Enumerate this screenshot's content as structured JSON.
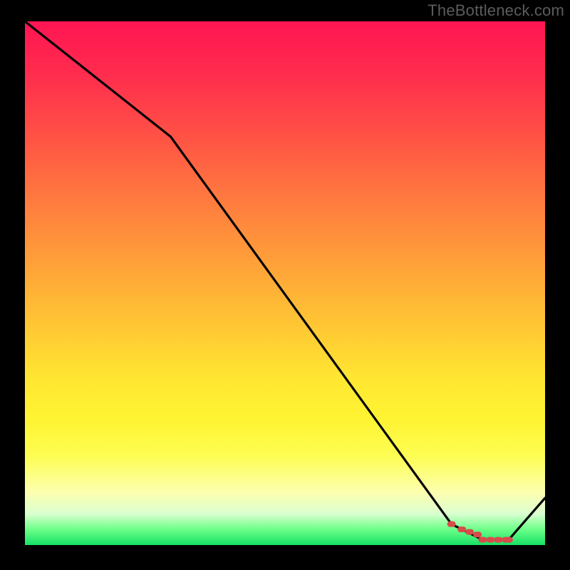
{
  "attribution": "TheBottleneck.com",
  "chart_data": {
    "type": "line",
    "title": "",
    "xlabel": "",
    "ylabel": "",
    "xlim": [
      0,
      100
    ],
    "ylim": [
      0,
      100
    ],
    "x": [
      0,
      28,
      82,
      88,
      93,
      100
    ],
    "values": [
      100,
      78,
      4,
      1,
      1,
      9
    ],
    "markers": {
      "x": [
        82,
        84,
        85.5,
        87,
        88,
        89.5,
        91,
        92.5,
        93
      ],
      "values": [
        4,
        3,
        2.5,
        2,
        1,
        1,
        1,
        1,
        1
      ]
    },
    "gradient_stops": [
      {
        "pos": 0.0,
        "color": "#ff1552"
      },
      {
        "pos": 0.1,
        "color": "#ff2c4e"
      },
      {
        "pos": 0.22,
        "color": "#ff5245"
      },
      {
        "pos": 0.34,
        "color": "#ff7a3f"
      },
      {
        "pos": 0.46,
        "color": "#ffa039"
      },
      {
        "pos": 0.58,
        "color": "#ffc634"
      },
      {
        "pos": 0.68,
        "color": "#ffe631"
      },
      {
        "pos": 0.76,
        "color": "#fff432"
      },
      {
        "pos": 0.83,
        "color": "#fdfd53"
      },
      {
        "pos": 0.9,
        "color": "#fcffb0"
      },
      {
        "pos": 0.94,
        "color": "#dbffd0"
      },
      {
        "pos": 0.97,
        "color": "#6cff88"
      },
      {
        "pos": 1.0,
        "color": "#16e166"
      }
    ]
  }
}
